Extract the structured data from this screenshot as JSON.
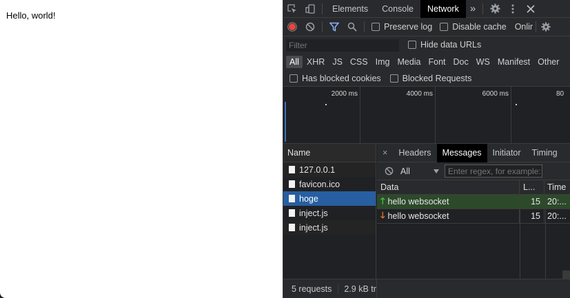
{
  "page": {
    "text": "Hello, world!"
  },
  "devtools": {
    "tabs": [
      "Elements",
      "Console",
      "Network"
    ],
    "active_tab": "Network",
    "more_tabs_glyph": "»",
    "toolbar": {
      "preserve_log": "Preserve log",
      "disable_cache": "Disable cache",
      "throttle": "Onlir"
    },
    "filter": {
      "placeholder": "Filter",
      "hide_data_urls": "Hide data URLs"
    },
    "type_filters": [
      "All",
      "XHR",
      "JS",
      "CSS",
      "Img",
      "Media",
      "Font",
      "Doc",
      "WS",
      "Manifest",
      "Other"
    ],
    "blocked": {
      "has_blocked_cookies": "Has blocked cookies",
      "blocked_requests": "Blocked Requests"
    },
    "overview_ticks": [
      "2000 ms",
      "4000 ms",
      "6000 ms",
      "80"
    ],
    "requests": {
      "header": "Name",
      "items": [
        "127.0.0.1",
        "favicon.ico",
        "hoge",
        "inject.js",
        "inject.js"
      ],
      "selected": "hoge"
    },
    "detail": {
      "close_glyph": "×",
      "tabs": [
        "Headers",
        "Messages",
        "Initiator",
        "Timing"
      ],
      "active_tab": "Messages",
      "filter_select": "All",
      "regex_placeholder": "Enter regex, for example:",
      "columns": {
        "data": "Data",
        "length": "L...",
        "time": "Time"
      },
      "messages": [
        {
          "direction": "sent",
          "data": "hello websocket",
          "length": "15",
          "time": "20:..."
        },
        {
          "direction": "received",
          "data": "hello websocket",
          "length": "15",
          "time": "20:..."
        }
      ]
    },
    "status": {
      "requests": "5 requests",
      "transferred": "2.9 kB tr"
    },
    "colors": {
      "selected_row": "#275fa1",
      "sent_row": "#2c4a2a",
      "record": "#e8453c",
      "filter_active": "#8ab4f8"
    }
  }
}
